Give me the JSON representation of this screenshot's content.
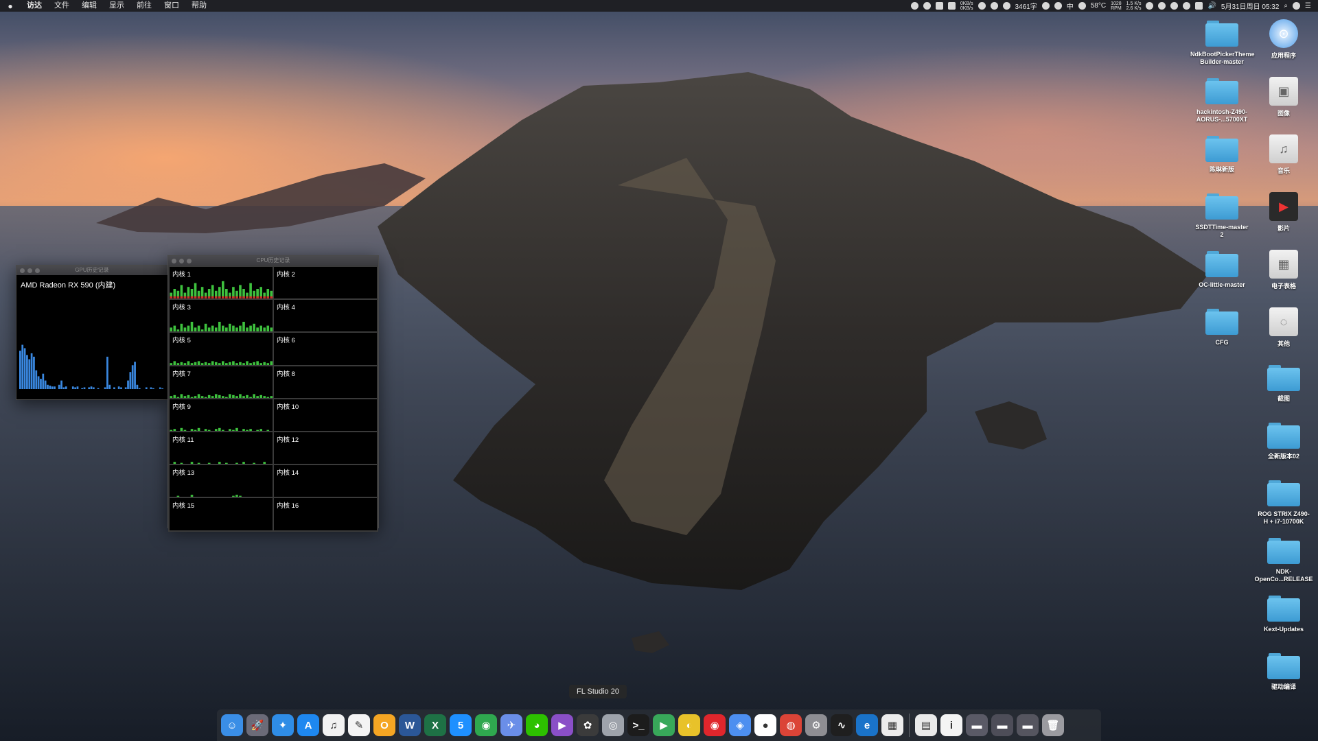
{
  "menubar": {
    "apple": "",
    "items": [
      {
        "label": "访达",
        "app": true
      },
      {
        "label": "文件"
      },
      {
        "label": "编辑"
      },
      {
        "label": "显示"
      },
      {
        "label": "前往"
      },
      {
        "label": "窗口"
      },
      {
        "label": "帮助"
      }
    ],
    "status": {
      "net_up": "0KB/s",
      "net_down": "0KB/s",
      "words": "3461字",
      "ime": "中",
      "temp": "58°C",
      "rpm_value": "1028",
      "rpm_unit": "RPM",
      "net_rate_up": "1.5 K/s",
      "net_rate_down": "2.6 K/s",
      "clock": "5月31日周日 05:32"
    }
  },
  "gpu_window": {
    "title": "GPU历史记录",
    "gpu_name": "AMD Radeon RX 590 (内建)",
    "history": [
      0.45,
      0.52,
      0.48,
      0.4,
      0.35,
      0.42,
      0.38,
      0.22,
      0.15,
      0.12,
      0.18,
      0.1,
      0.05,
      0.04,
      0.03,
      0.03,
      0.0,
      0.05,
      0.1,
      0.02,
      0.03,
      0.0,
      0.0,
      0.03,
      0.02,
      0.03,
      0.0,
      0.01,
      0.02,
      0.0,
      0.02,
      0.03,
      0.02,
      0.0,
      0.01,
      0.0,
      0.0,
      0.02,
      0.38,
      0.05,
      0.0,
      0.02,
      0.0,
      0.03,
      0.02,
      0.0,
      0.02,
      0.1,
      0.2,
      0.28,
      0.32,
      0.05,
      0.01,
      0.0,
      0.0,
      0.02,
      0.0,
      0.02,
      0.01,
      0.0,
      0.0,
      0.02,
      0.01,
      0.0
    ]
  },
  "cpu_window": {
    "title": "CPU历史记录",
    "cores": [
      {
        "name": "内核 1",
        "load": [
          0.3,
          0.5,
          0.4,
          0.7,
          0.3,
          0.6,
          0.5,
          0.8,
          0.4,
          0.6,
          0.3,
          0.5,
          0.7,
          0.4,
          0.6,
          0.9,
          0.5,
          0.3,
          0.6,
          0.4,
          0.7,
          0.5,
          0.3,
          0.8,
          0.4,
          0.5,
          0.6,
          0.3,
          0.5,
          0.4
        ]
      },
      {
        "name": "内核 2",
        "load": []
      },
      {
        "name": "内核 3",
        "load": [
          0.2,
          0.3,
          0.1,
          0.4,
          0.2,
          0.3,
          0.5,
          0.2,
          0.3,
          0.1,
          0.4,
          0.2,
          0.3,
          0.2,
          0.5,
          0.3,
          0.2,
          0.4,
          0.3,
          0.2,
          0.3,
          0.5,
          0.2,
          0.3,
          0.4,
          0.2,
          0.3,
          0.2,
          0.3,
          0.2
        ]
      },
      {
        "name": "内核 4",
        "load": []
      },
      {
        "name": "内核 5",
        "load": [
          0.1,
          0.2,
          0.1,
          0.15,
          0.1,
          0.2,
          0.1,
          0.15,
          0.2,
          0.1,
          0.15,
          0.1,
          0.2,
          0.15,
          0.1,
          0.2,
          0.1,
          0.15,
          0.2,
          0.1,
          0.15,
          0.1,
          0.2,
          0.1,
          0.15,
          0.2,
          0.1,
          0.15,
          0.1,
          0.2
        ]
      },
      {
        "name": "内核 6",
        "load": []
      },
      {
        "name": "内核 7",
        "load": [
          0.1,
          0.15,
          0.05,
          0.2,
          0.1,
          0.15,
          0.05,
          0.1,
          0.2,
          0.1,
          0.05,
          0.15,
          0.1,
          0.2,
          0.15,
          0.1,
          0.05,
          0.2,
          0.15,
          0.1,
          0.2,
          0.1,
          0.15,
          0.05,
          0.2,
          0.1,
          0.15,
          0.1,
          0.05,
          0.1
        ]
      },
      {
        "name": "内核 8",
        "load": []
      },
      {
        "name": "内核 9",
        "load": [
          0.05,
          0.1,
          0.0,
          0.15,
          0.05,
          0.0,
          0.1,
          0.05,
          0.15,
          0.0,
          0.1,
          0.05,
          0.0,
          0.1,
          0.15,
          0.05,
          0.0,
          0.1,
          0.05,
          0.15,
          0.0,
          0.1,
          0.05,
          0.1,
          0.0,
          0.05,
          0.1,
          0.0,
          0.05,
          0.0
        ]
      },
      {
        "name": "内核 10",
        "load": []
      },
      {
        "name": "内核 11",
        "load": [
          0.0,
          0.1,
          0.0,
          0.05,
          0.0,
          0.0,
          0.1,
          0.0,
          0.05,
          0.0,
          0.0,
          0.05,
          0.0,
          0.0,
          0.1,
          0.0,
          0.05,
          0.0,
          0.0,
          0.05,
          0.0,
          0.1,
          0.0,
          0.0,
          0.05,
          0.0,
          0.0,
          0.1,
          0.0,
          0.0
        ]
      },
      {
        "name": "内核 12",
        "load": []
      },
      {
        "name": "内核 13",
        "load": [
          0.0,
          0.0,
          0.05,
          0.0,
          0.0,
          0.0,
          0.1,
          0.0,
          0.0,
          0.0,
          0.0,
          0.0,
          0.0,
          0.0,
          0.0,
          0.0,
          0.0,
          0.0,
          0.05,
          0.1,
          0.05,
          0.0,
          0.0,
          0.0,
          0.0,
          0.0,
          0.0,
          0.0,
          0.0,
          0.0
        ]
      },
      {
        "name": "内核 14",
        "load": []
      },
      {
        "name": "内核 15",
        "load": [
          0.0,
          0.0,
          0.0,
          0.0,
          0.0,
          0.0,
          0.0,
          0.0,
          0.0,
          0.0,
          0.0,
          0.0,
          0.0,
          0.0,
          0.0,
          0.0,
          0.0,
          0.0,
          0.0,
          0.0,
          0.0,
          0.0,
          0.0,
          0.0,
          0.0,
          0.0,
          0.0,
          0.0,
          0.0,
          0.0
        ]
      },
      {
        "name": "内核 16",
        "load": []
      }
    ]
  },
  "desktop_icons_col1": [
    {
      "name": "NdkBootPickerTheme\nBuilder-master",
      "kind": "folder"
    },
    {
      "name": "hackintosh-Z490-\nAORUS-...5700XT",
      "kind": "folder"
    },
    {
      "name": "陈琳新版",
      "kind": "folder"
    },
    {
      "name": "SSDTTime-master\n2",
      "kind": "folder"
    },
    {
      "name": "OC-little-master",
      "kind": "folder"
    },
    {
      "name": "CFG",
      "kind": "folder"
    }
  ],
  "desktop_icons_col2": [
    {
      "name": "应用程序",
      "kind": "app-icon"
    },
    {
      "name": "图像",
      "kind": "image-icon"
    },
    {
      "name": "音乐",
      "kind": "music-icon"
    },
    {
      "name": "影片",
      "kind": "movie-icon"
    },
    {
      "name": "电子表格",
      "kind": "spreadsheet-icon"
    },
    {
      "name": "其他",
      "kind": "other-icon"
    },
    {
      "name": "截图",
      "kind": "folder"
    },
    {
      "name": "全新版本02",
      "kind": "folder"
    },
    {
      "name": "ROG STRIX Z490-\nH + i7-10700K",
      "kind": "folder"
    },
    {
      "name": "NDK-\nOpenCo...RELEASE",
      "kind": "folder"
    },
    {
      "name": "Kext-Updates",
      "kind": "folder"
    },
    {
      "name": "驱动编译",
      "kind": "folder"
    }
  ],
  "dock": {
    "tooltip": "FL Studio 20",
    "apps": [
      {
        "name": "finder-icon",
        "glyph": "☺",
        "color": "#3a8ee6"
      },
      {
        "name": "launchpad-icon",
        "glyph": "🚀",
        "color": "#6b6b78"
      },
      {
        "name": "safari-icon",
        "glyph": "✦",
        "color": "#2f8de6"
      },
      {
        "name": "app-store-icon",
        "glyph": "A",
        "color": "#1e88f0"
      },
      {
        "name": "music-icon",
        "glyph": "♫",
        "color": "#f2f2f2"
      },
      {
        "name": "pages-icon",
        "glyph": "✎",
        "color": "#f4f4f4"
      },
      {
        "name": "ticket-icon",
        "glyph": "O",
        "color": "#f5a623"
      },
      {
        "name": "word-icon",
        "glyph": "W",
        "color": "#2b5797"
      },
      {
        "name": "excel-icon",
        "glyph": "X",
        "color": "#1e7145"
      },
      {
        "name": "5-icon",
        "glyph": "5",
        "color": "#1e90ff"
      },
      {
        "name": "globe-icon",
        "glyph": "◉",
        "color": "#2fa84f"
      },
      {
        "name": "feather-icon",
        "glyph": "✈",
        "color": "#6a8ee8"
      },
      {
        "name": "wechat-icon",
        "glyph": "◕",
        "color": "#2dc100"
      },
      {
        "name": "final-cut-icon",
        "glyph": "▶",
        "color": "#8a4fc7"
      },
      {
        "name": "fl-studio-icon",
        "glyph": "✿",
        "color": "#3b3b3b"
      },
      {
        "name": "disk-utility-icon",
        "glyph": "◎",
        "color": "#9ea3ab"
      },
      {
        "name": "terminal-icon",
        "glyph": ">_",
        "color": "#1c1c1c"
      },
      {
        "name": "infuse-icon",
        "glyph": "▶",
        "color": "#38a85a"
      },
      {
        "name": "iqiyi-icon",
        "glyph": "◐",
        "color": "#e8c22a"
      },
      {
        "name": "netease-music-icon",
        "glyph": "◉",
        "color": "#e0262c"
      },
      {
        "name": "baidu-netdisk-icon",
        "glyph": "◈",
        "color": "#4d8ff0"
      },
      {
        "name": "qq-icon",
        "glyph": "●",
        "color": "#ffffff"
      },
      {
        "name": "chrome-icon",
        "glyph": "◍",
        "color": "#db4437"
      },
      {
        "name": "system-preferences-icon",
        "glyph": "⚙",
        "color": "#8e8e93"
      },
      {
        "name": "activity-monitor-icon",
        "glyph": "∿",
        "color": "#1f1f1f"
      },
      {
        "name": "edge-icon",
        "glyph": "e",
        "color": "#1a73c9"
      },
      {
        "name": "piano-icon",
        "glyph": "▦",
        "color": "#ececec"
      }
    ],
    "right_items": [
      {
        "name": "document-icon",
        "glyph": "▤",
        "color": "#eaeaea"
      },
      {
        "name": "info-icon",
        "glyph": "i",
        "color": "#f4f4f4"
      },
      {
        "name": "screen-thumb-1-icon",
        "glyph": "▬",
        "color": "#5a5a66"
      },
      {
        "name": "screen-thumb-2-icon",
        "glyph": "▬",
        "color": "#4d4d58"
      },
      {
        "name": "screen-thumb-3-icon",
        "glyph": "▬",
        "color": "#55555f"
      },
      {
        "name": "trash-icon",
        "glyph": "🗑",
        "color": "#9b9ba0"
      }
    ]
  },
  "colors": {
    "cpu_bar": "#3ec13e",
    "cpu_bar_red": "#d12828",
    "gpu_bar": "#3a88e0"
  }
}
